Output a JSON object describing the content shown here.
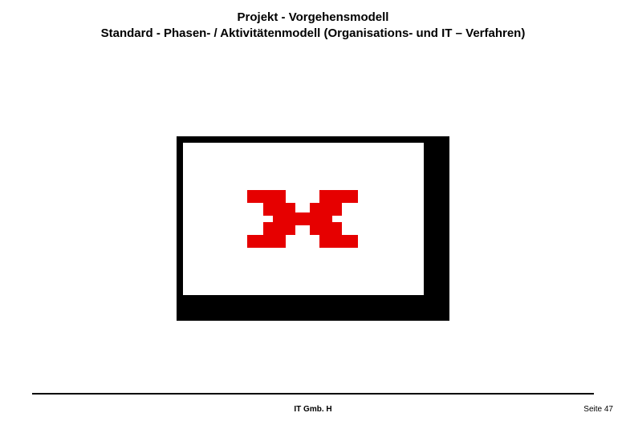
{
  "header": {
    "title_line1": "Projekt - Vorgehensmodell",
    "title_line2": "Standard - Phasen- / Aktivitätenmodell (Organisations- und IT – Verfahren)"
  },
  "footer": {
    "center": "IT Gmb. H",
    "page_label": "Seite 47"
  }
}
